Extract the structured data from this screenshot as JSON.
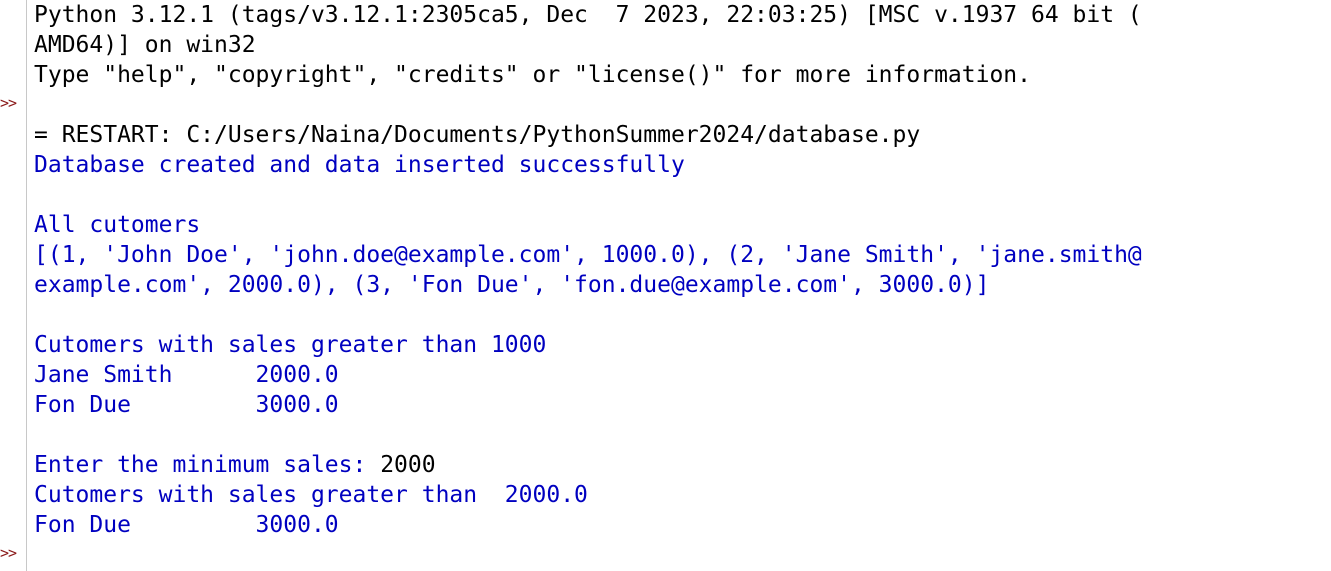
{
  "shell": {
    "prompt_symbol": ">>",
    "banner": [
      "Python 3.12.1 (tags/v3.12.1:2305ca5, Dec  7 2023, 22:03:25) [MSC v.1937 64 bit (",
      "AMD64)] on win32",
      "Type \"help\", \"copyright\", \"credits\" or \"license()\" for more information."
    ],
    "restart_line": "= RESTART: C:/Users/Naina/Documents/PythonSummer2024/database.py",
    "output": {
      "created_msg": "Database created and data inserted successfully",
      "all_header": "All cutomers",
      "all_rows_line1": "[(1, 'John Doe', 'john.doe@example.com', 1000.0), (2, 'Jane Smith', 'jane.smith@",
      "all_rows_line2": "example.com', 2000.0), (3, 'Fon Due', 'fon.due@example.com', 3000.0)]",
      "sales_header_1": "Cutomers with sales greater than 1000",
      "sales_rows_1": [
        "Jane Smith      2000.0",
        "Fon Due         3000.0"
      ],
      "input_prompt": "Enter the minimum sales: ",
      "input_value": "2000",
      "sales_header_2": "Cutomers with sales greater than  2000.0",
      "sales_rows_2": [
        "Fon Due         3000.0"
      ]
    },
    "colors": {
      "stdout": "#0000c0",
      "stdin": "#000000",
      "prompt": "#8b1a1a",
      "background": "#ffffff"
    }
  }
}
